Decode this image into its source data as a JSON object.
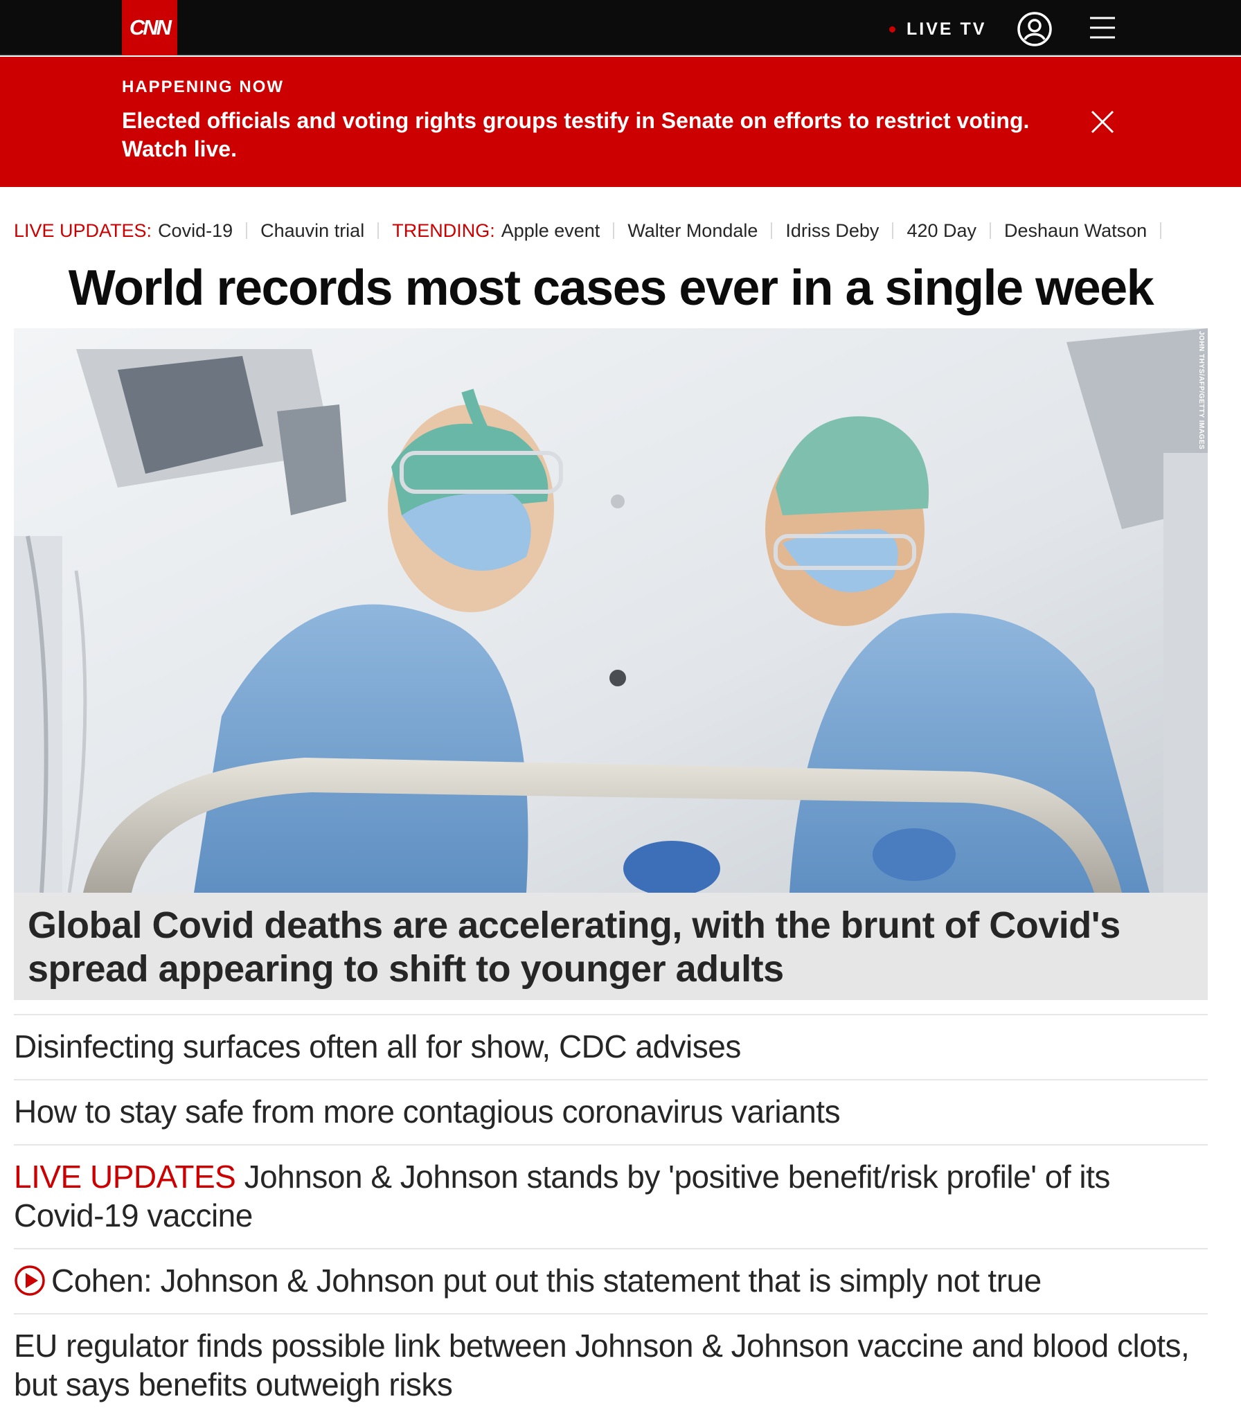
{
  "nav": {
    "logo_text": "CNN",
    "live_tv_label": "LIVE TV",
    "accent_color": "#cc0000",
    "icons": [
      "user-icon",
      "menu-icon"
    ]
  },
  "banner": {
    "kicker": "HAPPENING NOW",
    "headline": "Elected officials and voting rights groups testify in Senate on efforts to restrict voting. Watch live.",
    "close_icon": "close-icon"
  },
  "trending": {
    "live_label": "LIVE UPDATES:",
    "live_items": [
      "Covid-19",
      "Chauvin trial"
    ],
    "trending_label": "TRENDING:",
    "trending_items": [
      "Apple event",
      "Walter Mondale",
      "Idriss Deby",
      "420 Day",
      "Deshaun Watson"
    ]
  },
  "main": {
    "title": "World records most cases ever in a single week",
    "photo_credit": "JOHN THYS/AFP/GETTY IMAGES",
    "caption": "Global Covid deaths are accelerating, with the brunt of Covid's spread appearing to shift to younger adults"
  },
  "stories": [
    {
      "prefix": "",
      "text": "Disinfecting surfaces often all for show, CDC advises"
    },
    {
      "prefix": "",
      "text": "How to stay safe from more contagious coronavirus variants"
    },
    {
      "prefix": "LIVE UPDATES",
      "text": "Johnson & Johnson stands by 'positive benefit/risk profile' of its Covid-19 vaccine"
    },
    {
      "prefix": "",
      "text": "Cohen: Johnson & Johnson put out this statement that is simply not true",
      "icon": "play-icon"
    },
    {
      "prefix": "",
      "text": "EU regulator finds possible link between Johnson & Johnson vaccine and blood clots, but says benefits outweigh risks"
    }
  ]
}
